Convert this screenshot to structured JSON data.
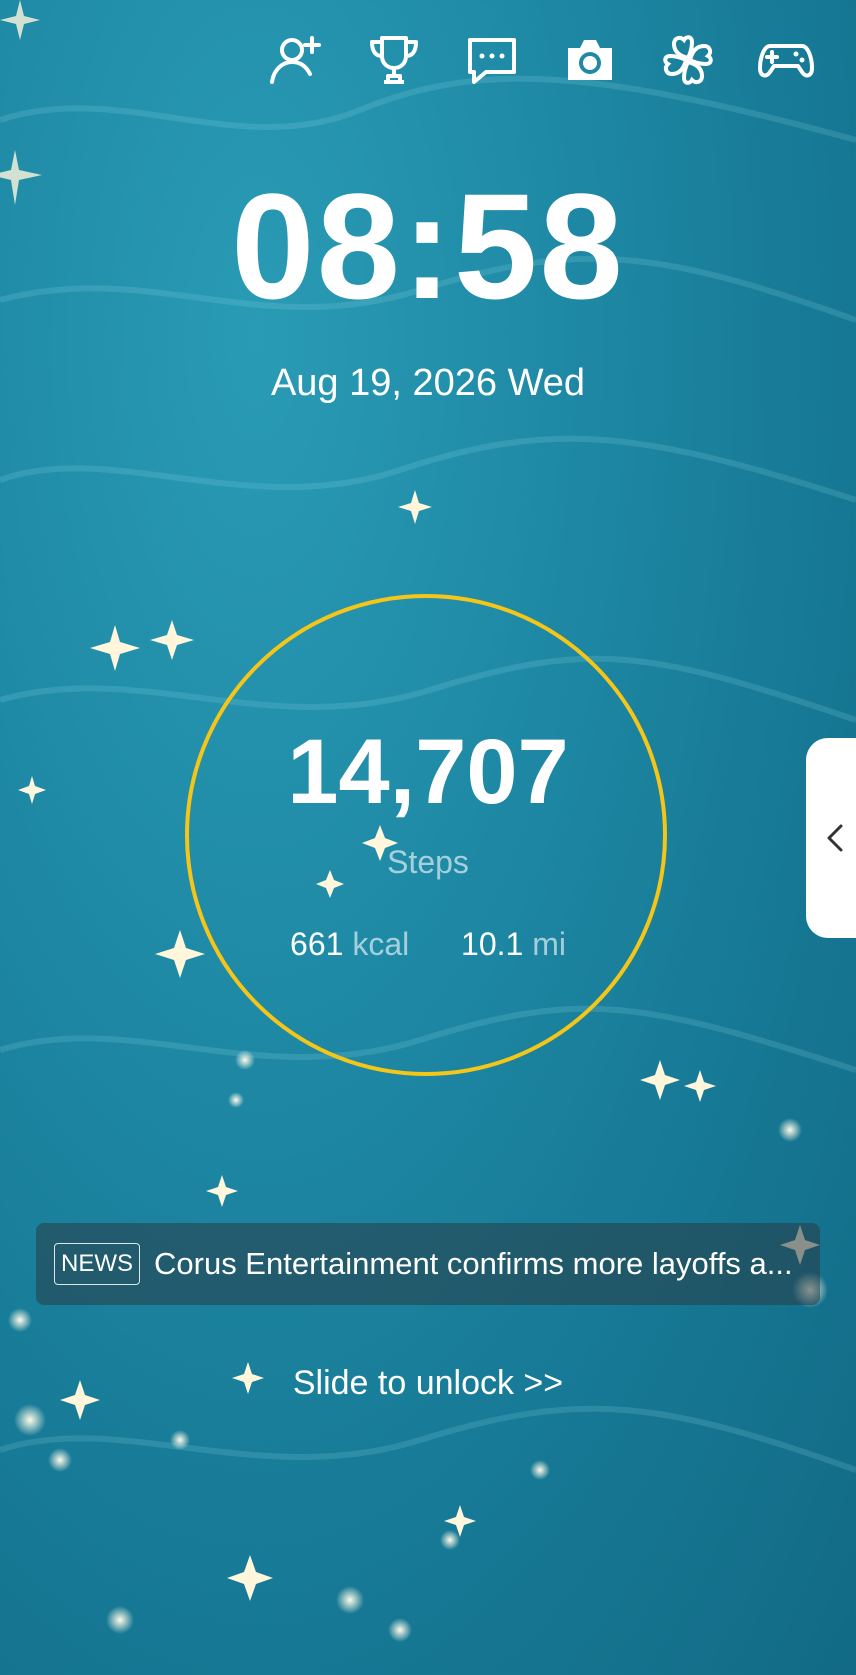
{
  "top_icons": [
    "add-friend-icon",
    "trophy-icon",
    "chat-icon",
    "camera-icon",
    "clover-icon",
    "gamepad-icon"
  ],
  "clock": {
    "time": "08:58",
    "date": "Aug 19, 2026 Wed"
  },
  "pedometer": {
    "steps": "14,707",
    "steps_label": "Steps",
    "kcal_value": "661",
    "kcal_unit": "kcal",
    "distance_value": "10.1",
    "distance_unit": "mi",
    "ring_color": "#f5c518"
  },
  "news": {
    "badge": "NEWS",
    "headline": "Corus Entertainment confirms more layoffs a..."
  },
  "unlock_text": "Slide to unlock >>",
  "colors": {
    "background": "#1f8aa6",
    "accent": "#f5c518",
    "text": "#ffffff"
  }
}
